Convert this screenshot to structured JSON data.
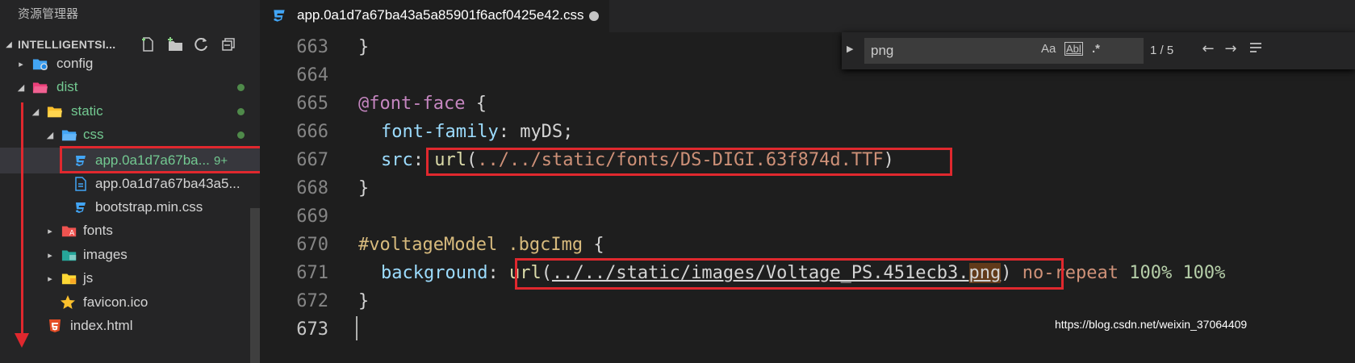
{
  "sidebar": {
    "title": "资源管理器",
    "project_name": "INTELLIGENTSI...",
    "items": [
      {
        "label": "config",
        "type": "folder"
      },
      {
        "label": "dist",
        "type": "folder"
      },
      {
        "label": "static",
        "type": "folder"
      },
      {
        "label": "css",
        "type": "folder"
      },
      {
        "label": "app.0a1d7a67ba...",
        "badge": "9+",
        "type": "css"
      },
      {
        "label": "app.0a1d7a67ba43a5...",
        "type": "css"
      },
      {
        "label": "bootstrap.min.css",
        "type": "css"
      },
      {
        "label": "fonts",
        "type": "folder"
      },
      {
        "label": "images",
        "type": "folder"
      },
      {
        "label": "js",
        "type": "folder"
      },
      {
        "label": "favicon.ico",
        "type": "star"
      },
      {
        "label": "index.html",
        "type": "html"
      }
    ]
  },
  "tab": {
    "label": "app.0a1d7a67ba43a5a85901f6acf0425e42.css"
  },
  "find": {
    "value": "png",
    "match_case": "Aa",
    "whole_word": "Abl",
    "regex": ".*",
    "count": "1 / 5",
    "prev": "←",
    "next": "→"
  },
  "editor": {
    "line_numbers": [
      "663",
      "664",
      "665",
      "666",
      "667",
      "668",
      "669",
      "670",
      "671",
      "672",
      "673"
    ],
    "l663": "}",
    "l665_at": "@font-face",
    "l665_brace": " {",
    "l666_prop": "font-family",
    "l666_rest": ": myDS;",
    "l667_prop": "src",
    "l667_colon": ": ",
    "l667_fn": "url",
    "l667_open": "(",
    "l667_path": "../../static/fonts/DS-DIGI.63f874d.TTF",
    "l667_close": ")",
    "l668": "}",
    "l670_sel": "#voltageModel",
    "l670_cls": " .bgcImg",
    "l670_brace": " {",
    "l671_prop": "background",
    "l671_colon": ": ",
    "l671_fn": "url",
    "l671_open": "(",
    "l671_path": "../../static/images/Voltage_PS.451ecb3.",
    "l671_match": "png",
    "l671_close": ")",
    "l671_kw": " no-repeat",
    "l671_num": " 100% 100%",
    "l672": "}"
  },
  "watermark": "https://blog.csdn.net/weixin_37064409",
  "colors": {
    "highlight_box": "#e0282e",
    "git_modified": "#73c991",
    "accent": "#c586c0"
  }
}
